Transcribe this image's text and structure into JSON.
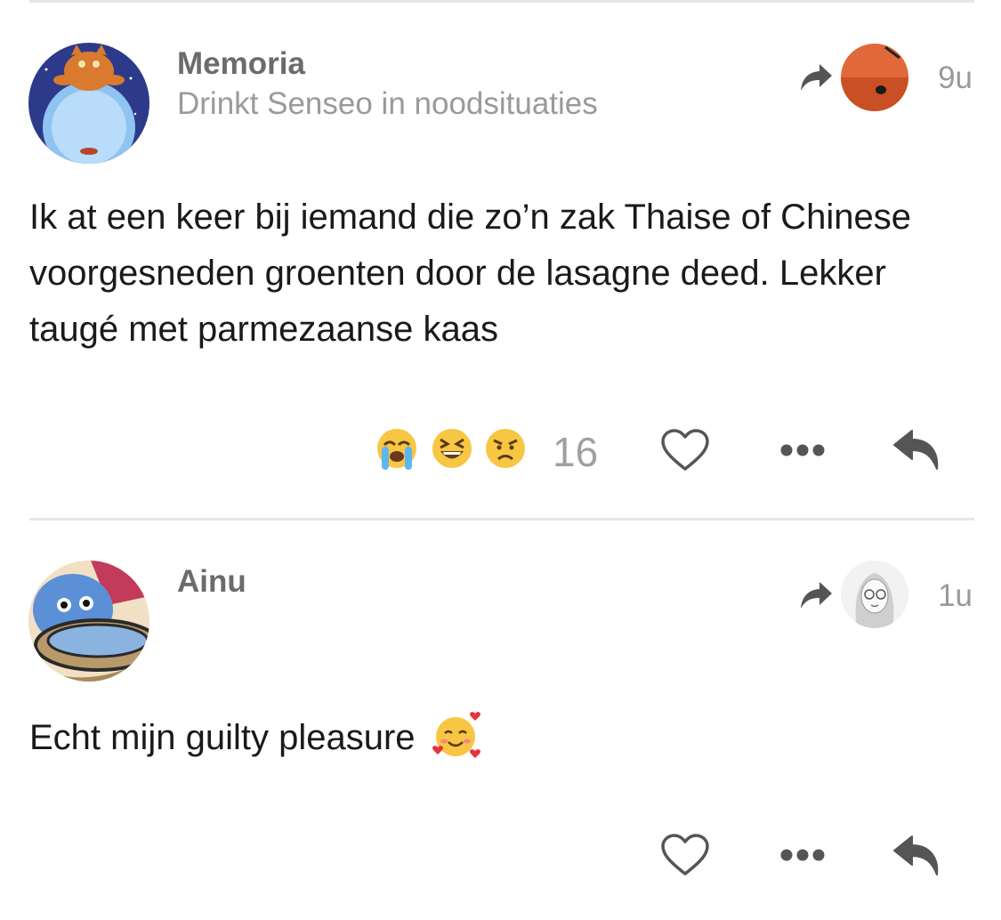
{
  "comments": [
    {
      "author": "Memoria",
      "tagline": "Drinkt Senseo in noodsituaties",
      "time": "9u",
      "text": "Ik at een keer bij iemand die zo’n zak Thaise of Chinese voorgesneden groenten door de lasagne deed. Lekker taugé met parmezaanse kaas",
      "reactions": {
        "emojis": [
          "loudly-crying-face",
          "grinning-squinting-face",
          "angry-face"
        ],
        "count": "16"
      }
    },
    {
      "author": "Ainu",
      "time": "1u",
      "text": "Echt mijn guilty pleasure",
      "text_emoji": "smiling-face-with-hearts"
    }
  ],
  "colors": {
    "author": "#6b6b6b",
    "secondary": "#9a9a9a",
    "icon": "#555555",
    "divider": "#e6e6e6"
  },
  "icons": [
    "reply-to-icon",
    "heart-icon",
    "more-icon",
    "reply-icon"
  ]
}
